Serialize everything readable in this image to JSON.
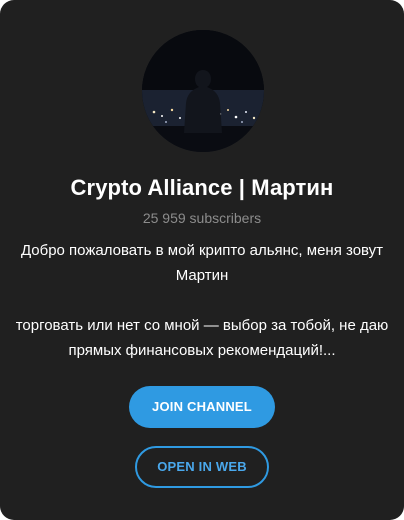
{
  "channel": {
    "title": "Crypto Alliance | Мартин",
    "subscribers": "25 959 subscribers",
    "description_lines": [
      "Добро пожаловать в мой крипто альянс, меня зовут Мартин",
      "торговать или нет со мной — выбор за тобой, не даю прямых финансовых рекомендаций!..."
    ],
    "avatar_icon": "channel-avatar-photo"
  },
  "actions": {
    "join_label": "JOIN CHANNEL",
    "web_label": "OPEN IN WEB"
  },
  "colors": {
    "background": "#202020",
    "accent": "#2f9ae2",
    "muted_text": "#8c8c8c",
    "text": "#ffffff"
  }
}
